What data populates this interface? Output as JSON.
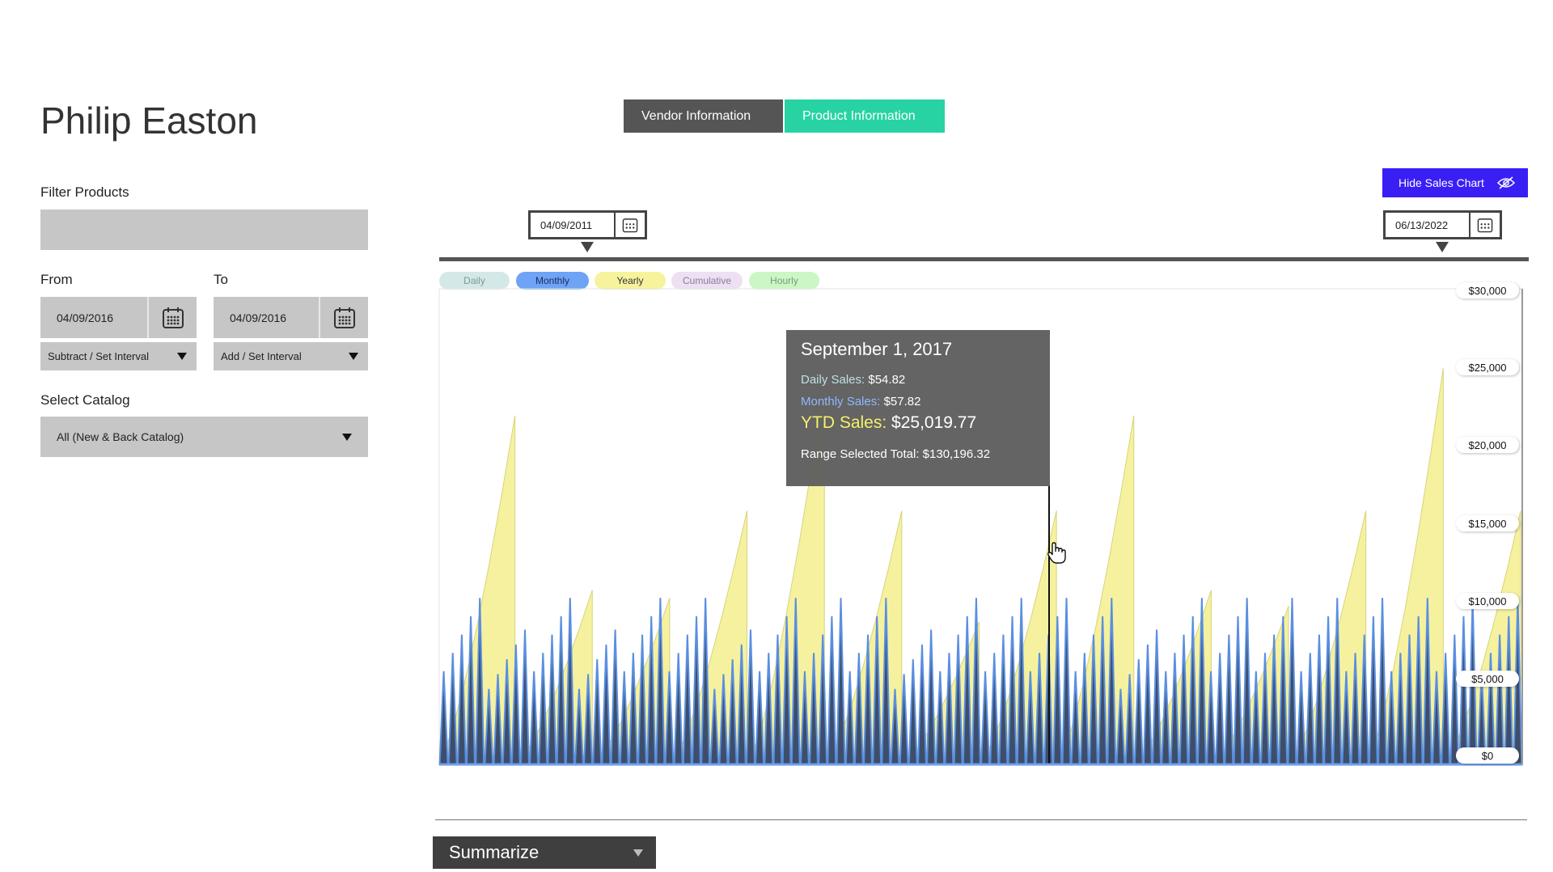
{
  "page": {
    "user_name": "Philip Easton"
  },
  "filter": {
    "label": "Filter Products",
    "value": ""
  },
  "from": {
    "label": "From",
    "date": "04/09/2016",
    "interval": "Subtract / Set Interval"
  },
  "to": {
    "label": "To",
    "date": "04/09/2016",
    "interval": "Add / Set Interval"
  },
  "catalog": {
    "label": "Select Catalog",
    "value": "All (New & Back Catalog)"
  },
  "tabs": [
    {
      "label": "Vendor Information",
      "active": false
    },
    {
      "label": "Product Information",
      "active": true
    }
  ],
  "hide_chart": {
    "label": "Hide Sales Chart",
    "icon": "eye-off-icon"
  },
  "range": {
    "start": "04/09/2011",
    "end": "06/13/2022"
  },
  "toggles": [
    {
      "label": "Daily",
      "bg": "#d4e8e8",
      "fg": "#7a9a9a"
    },
    {
      "label": "Monthly",
      "bg": "#6ea3f5",
      "fg": "#1b2f5a"
    },
    {
      "label": "Yearly",
      "bg": "#f6f39c",
      "fg": "#333333"
    },
    {
      "label": "Cumulative",
      "bg": "#ede0f2",
      "fg": "#8a7a9a"
    },
    {
      "label": "Hourly",
      "bg": "#cdf6c6",
      "fg": "#7a9a7a"
    }
  ],
  "tooltip": {
    "date": "September 1, 2017",
    "daily_label": "Daily Sales:",
    "daily_value": "$54.82",
    "monthly_label": "Monthly Sales:",
    "monthly_value": "$57.82",
    "ytd_label": "YTD Sales:",
    "ytd_value": "$25,019.77",
    "range_label": "Range Selected Total:",
    "range_value": "$130,196.32"
  },
  "summarize": {
    "label": "Summarize"
  },
  "colors": {
    "tab_dark": "#555555",
    "tab_active": "#27d3a3",
    "hide_button": "#3a1ff5",
    "yearly_fill": "#f3ef8e",
    "monthly_fill": "#5a8fe0"
  },
  "chart_data": {
    "type": "area",
    "y_ticks": [
      "$30,000",
      "$25,000",
      "$20,000",
      "$15,000",
      "$10,000",
      "$5,000",
      "$0"
    ],
    "ylim": [
      0,
      30000
    ],
    "x_range": [
      "04/09/2011",
      "06/13/2022"
    ],
    "series": [
      {
        "name": "Yearly",
        "type": "area",
        "color": "#f3ef8e",
        "values": [
          22000,
          11000,
          10500,
          16000,
          24000,
          16000,
          9000,
          16000,
          22000,
          11000,
          10000,
          16000,
          25000,
          16000
        ]
      },
      {
        "name": "Monthly",
        "type": "bar",
        "color": "#5a8fe0",
        "peaks": [
          10500,
          8500,
          10500,
          8500,
          10500,
          10500,
          8500,
          10500,
          10500,
          10500,
          8500,
          10500,
          10500,
          10500,
          10500,
          8500,
          10500,
          10500,
          10500,
          10500,
          10500,
          10500,
          10500,
          10500
        ]
      }
    ]
  }
}
